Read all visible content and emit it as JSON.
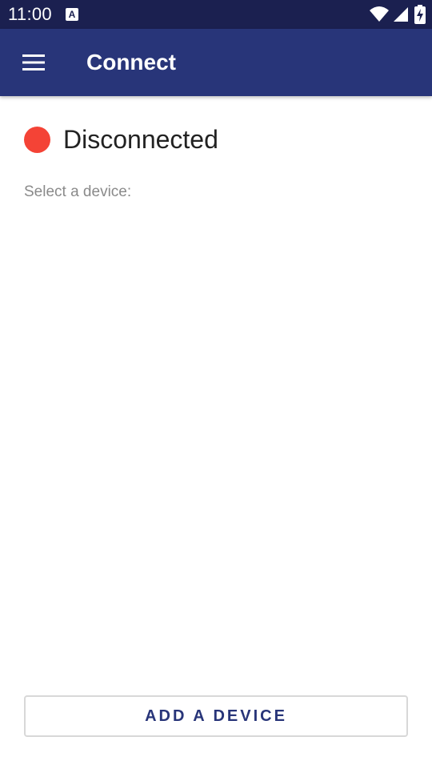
{
  "statusbar": {
    "time": "11:00",
    "notification_badge": "A",
    "icons": [
      "wifi-icon",
      "cell-signal-icon",
      "battery-charging-icon"
    ]
  },
  "appbar": {
    "title": "Connect",
    "menu_icon": "hamburger-menu-icon"
  },
  "connection": {
    "status": "Disconnected",
    "status_color": "#f44336"
  },
  "devices": {
    "label": "Select a device:",
    "items": []
  },
  "actions": {
    "add_device_label": "ADD A DEVICE"
  },
  "colors": {
    "statusbar_bg": "#1b2050",
    "appbar_bg": "#283579",
    "accent": "#283579",
    "disconnected": "#f44336"
  }
}
